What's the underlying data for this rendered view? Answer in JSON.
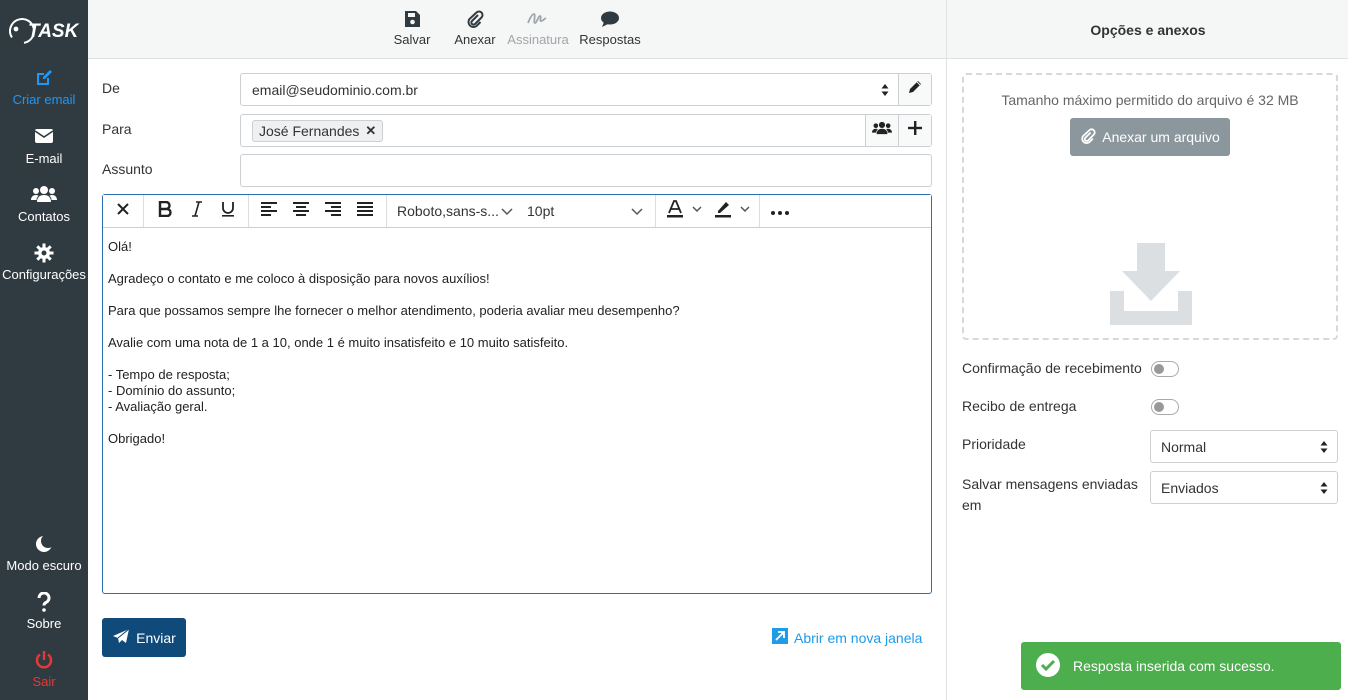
{
  "sidebar": {
    "logo_text": "TASK",
    "items": [
      {
        "label": "Criar email",
        "icon": "edit-icon"
      },
      {
        "label": "E-mail",
        "icon": "envelope-icon"
      },
      {
        "label": "Contatos",
        "icon": "users-icon"
      },
      {
        "label": "Configurações",
        "icon": "gear-icon"
      }
    ],
    "bottom": [
      {
        "label": "Modo escuro",
        "icon": "moon-icon"
      },
      {
        "label": "Sobre",
        "icon": "question-icon"
      },
      {
        "label": "Sair",
        "icon": "power-icon"
      }
    ]
  },
  "toolbar": {
    "save_label": "Salvar",
    "attach_label": "Anexar",
    "signature_label": "Assinatura",
    "replies_label": "Respostas"
  },
  "form": {
    "from_label": "De",
    "from_value": "email@seudominio.com.br",
    "to_label": "Para",
    "to_chip": "José Fernandes",
    "subject_label": "Assunto",
    "subject_value": ""
  },
  "editor": {
    "font_family": "Roboto,sans-s...",
    "font_size": "10pt",
    "body": [
      "Olá!",
      "Agradeço o contato e me coloco à disposição para novos auxílios!",
      "Para que possamos sempre lhe fornecer o melhor atendimento, poderia avaliar meu desempenho?",
      "Avalie com uma nota de 1 a 10, onde 1 é muito insatisfeito e 10 muito satisfeito.",
      "- Tempo de resposta;\n- Domínio do assunto;\n- Avaliação geral.",
      "Obrigado!"
    ]
  },
  "actions": {
    "send_label": "Enviar",
    "open_new_window": "Abrir em nova janela"
  },
  "panel": {
    "title": "Opções e anexos",
    "max_size_text": "Tamanho máximo permitido do arquivo é 32 MB",
    "attach_button": "Anexar um arquivo",
    "read_receipt_label": "Confirmação de recebimento",
    "delivery_receipt_label": "Recibo de entrega",
    "priority_label": "Prioridade",
    "priority_value": "Normal",
    "save_sent_label": "Salvar mensagens enviadas em",
    "save_sent_value": "Enviados"
  },
  "toast": {
    "message": "Resposta inserida com sucesso."
  },
  "colors": {
    "sidebar_bg": "#2f3b41",
    "active": "#2196f3",
    "danger": "#e53935",
    "send": "#0f4a7b",
    "link": "#1e9be9",
    "toast": "#4cae4c"
  }
}
